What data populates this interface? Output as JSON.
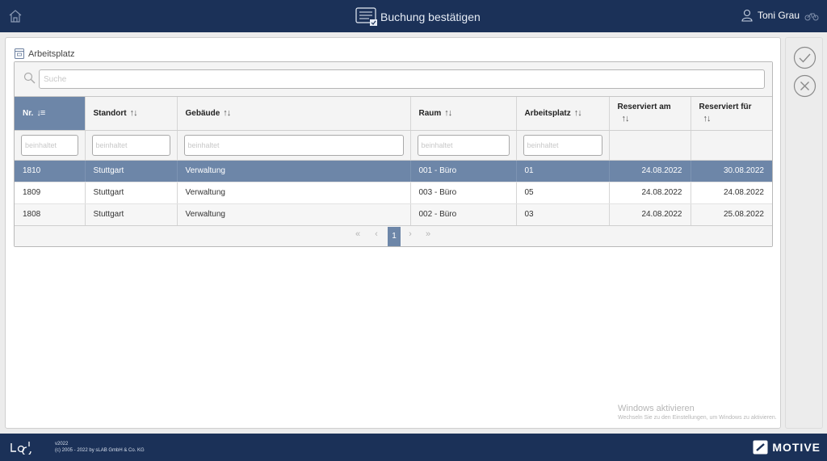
{
  "header": {
    "title": "Buchung bestätigen",
    "user_name": "Toni Grau"
  },
  "section": {
    "label": "Arbeitsplatz"
  },
  "search": {
    "placeholder": "Suche"
  },
  "table": {
    "columns": [
      {
        "label": "Nr.",
        "sort": "↓≡"
      },
      {
        "label": "Standort",
        "sort": "↑↓"
      },
      {
        "label": "Gebäude",
        "sort": "↑↓"
      },
      {
        "label": "Raum",
        "sort": "↑↓"
      },
      {
        "label": "Arbeitsplatz",
        "sort": "↑↓"
      },
      {
        "label": "Reserviert am",
        "sort": "↑↓"
      },
      {
        "label": "Reserviert für",
        "sort": "↑↓"
      }
    ],
    "filter_placeholder": "beinhaltet",
    "rows": [
      {
        "nr": "1810",
        "standort": "Stuttgart",
        "gebaeude": "Verwaltung",
        "raum": "001 - Büro",
        "arbeitsplatz": "01",
        "reserviert_am": "24.08.2022",
        "reserviert_fuer": "30.08.2022"
      },
      {
        "nr": "1809",
        "standort": "Stuttgart",
        "gebaeude": "Verwaltung",
        "raum": "003 - Büro",
        "arbeitsplatz": "05",
        "reserviert_am": "24.08.2022",
        "reserviert_fuer": "24.08.2022"
      },
      {
        "nr": "1808",
        "standort": "Stuttgart",
        "gebaeude": "Verwaltung",
        "raum": "002 - Büro",
        "arbeitsplatz": "03",
        "reserviert_am": "24.08.2022",
        "reserviert_fuer": "25.08.2022"
      }
    ],
    "selected_row": 0
  },
  "pagination": {
    "first": "«",
    "prev": "‹",
    "current": "1",
    "next": "›",
    "last": "»"
  },
  "watermark": {
    "title": "Windows aktivieren",
    "subtitle": "Wechseln Sie zu den Einstellungen, um Windows zu aktivieren."
  },
  "footer": {
    "version": "v2022",
    "copyright": "(c) 2005 - 2022 by sLAB GmbH & Co. KG",
    "brand": "MOTIVE"
  },
  "icons": {
    "home": "home-icon",
    "title": "confirm-booking-icon",
    "user": "user-icon",
    "bike": "bike-icon",
    "search": "search-icon",
    "confirm": "check-circle-icon",
    "cancel": "x-circle-icon"
  },
  "colors": {
    "nav": "#1b3158",
    "selection": "#6d86a8"
  }
}
